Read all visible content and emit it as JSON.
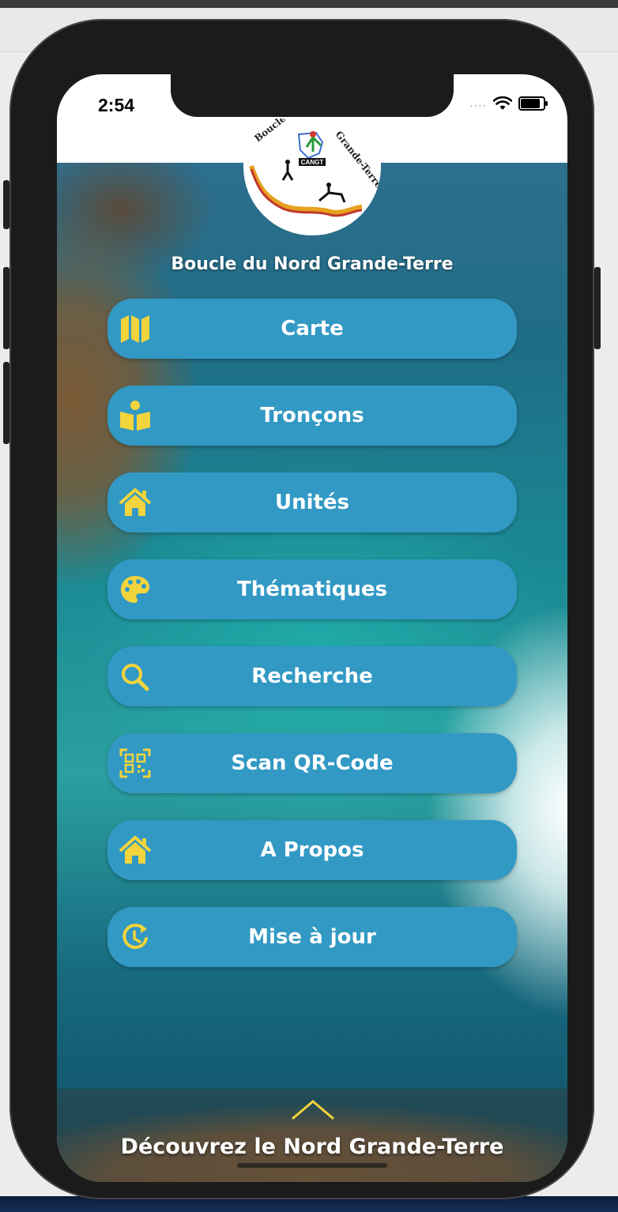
{
  "status_bar": {
    "time": "2:54"
  },
  "logo": {
    "text_ring": "-Boucle du Nord Grande-Terre-",
    "badge": "CANGT"
  },
  "app_title": "Boucle du Nord Grande-Terre",
  "colors": {
    "button": "#3299c4",
    "icon": "#f2d43c",
    "text": "#ffffff"
  },
  "menu": [
    {
      "label": "Carte",
      "icon": "map-icon"
    },
    {
      "label": "Tronçons",
      "icon": "reader-icon"
    },
    {
      "label": "Unités",
      "icon": "home-icon"
    },
    {
      "label": "Thématiques",
      "icon": "palette-icon"
    },
    {
      "label": "Recherche",
      "icon": "search-icon"
    },
    {
      "label": "Scan QR-Code",
      "icon": "qr-code-icon"
    },
    {
      "label": "A Propos",
      "icon": "home-icon"
    },
    {
      "label": "Mise à jour",
      "icon": "history-icon"
    }
  ],
  "footer": {
    "text": "Découvrez le Nord Grande-Terre"
  }
}
